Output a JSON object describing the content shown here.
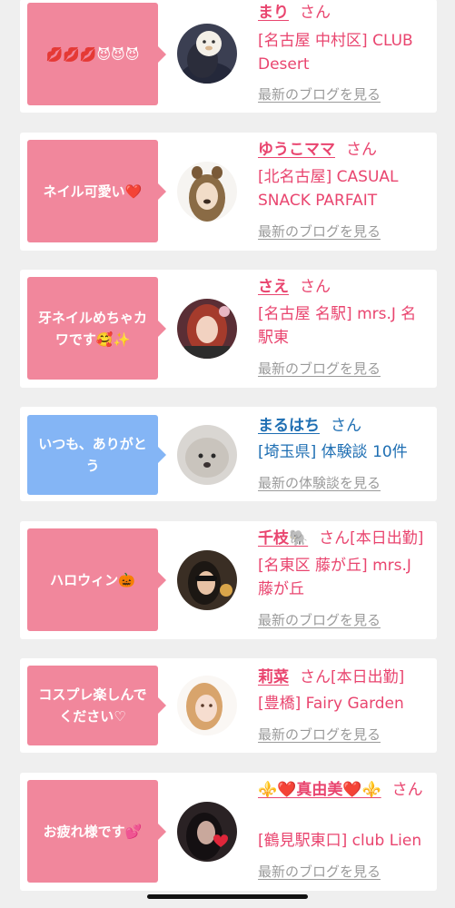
{
  "accent_pink": "#f1879c",
  "accent_blue": "#84b5f5",
  "text_pink": "#e9456f",
  "text_blue": "#1f6fb3",
  "posts": [
    {
      "message": "💋💋💋😈😈😈",
      "name": "まり",
      "honorific": "さん",
      "status": "",
      "place": "[名古屋 中村区] CLUB Desert",
      "link": "最新のブログを見る"
    },
    {
      "message": "ネイル可愛い❤️",
      "name": "ゆうこママ",
      "honorific": "さん",
      "status": "",
      "place": "[北名古屋] CASUAL SNACK PARFAIT",
      "link": "最新のブログを見る"
    },
    {
      "message": "牙ネイルめちゃカワです🥰✨",
      "name": "さえ",
      "honorific": "さん",
      "status": "",
      "place": "[名古屋 名駅] mrs.J 名駅東",
      "link": "最新のブログを見る"
    },
    {
      "message": "いつも、ありがとう",
      "name": "まるはち",
      "honorific": "さん",
      "status": "",
      "place": "[埼玉県] 体験談 10件",
      "link": "最新の体験談を見る"
    },
    {
      "message": "ハロウィン🎃",
      "name": "千枝🐘",
      "honorific": "さん",
      "status": "[本日出勤]",
      "place": "[名東区 藤が丘] mrs.J 藤が丘",
      "link": "最新のブログを見る"
    },
    {
      "message": "コスプレ楽しんでください♡",
      "name": "莉菜",
      "honorific": "さん",
      "status": "[本日出勤]",
      "place": "[豊橋] Fairy Garden",
      "link": "最新のブログを見る"
    },
    {
      "message": "お疲れ様です💕",
      "name": "⚜️❤️真由美❤️⚜️",
      "honorific": "さん",
      "status": "",
      "place": "[鶴見駅東口] club Lien",
      "link": "最新のブログを見る"
    }
  ]
}
